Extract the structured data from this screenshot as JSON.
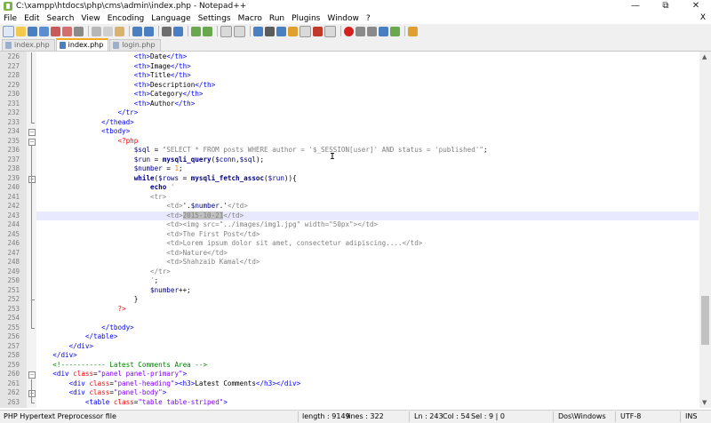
{
  "window": {
    "title": "C:\\xampp\\htdocs\\php\\cms\\admin\\index.php - Notepad++",
    "minimize": "—",
    "maximize": "⧉",
    "close": "✕"
  },
  "menu": {
    "items": [
      "File",
      "Edit",
      "Search",
      "View",
      "Encoding",
      "Language",
      "Settings",
      "Macro",
      "Run",
      "Plugins",
      "Window",
      "?"
    ],
    "close_x": "X"
  },
  "tabs": [
    {
      "label": "index.php",
      "active": false
    },
    {
      "label": "index.php",
      "active": true
    },
    {
      "label": "login.php",
      "active": false
    }
  ],
  "editor": {
    "current_line": 243,
    "lines": [
      {
        "n": 226,
        "html": "                        <span class='c-tag'>&lt;th&gt;</span>Date<span class='c-tag'>&lt;/th&gt;</span>"
      },
      {
        "n": 227,
        "html": "                        <span class='c-tag'>&lt;th&gt;</span>Image<span class='c-tag'>&lt;/th&gt;</span>"
      },
      {
        "n": 228,
        "html": "                        <span class='c-tag'>&lt;th&gt;</span>Title<span class='c-tag'>&lt;/th&gt;</span>"
      },
      {
        "n": 229,
        "html": "                        <span class='c-tag'>&lt;th&gt;</span>Description<span class='c-tag'>&lt;/th&gt;</span>"
      },
      {
        "n": 230,
        "html": "                        <span class='c-tag'>&lt;th&gt;</span>Category<span class='c-tag'>&lt;/th&gt;</span>"
      },
      {
        "n": 231,
        "html": "                        <span class='c-tag'>&lt;th&gt;</span>Author<span class='c-tag'>&lt;/th&gt;</span>"
      },
      {
        "n": 232,
        "html": "                    <span class='c-tag'>&lt;/tr&gt;</span>"
      },
      {
        "n": 233,
        "html": "                <span class='c-tag'>&lt;/thead&gt;</span>"
      },
      {
        "n": 234,
        "html": "                <span class='c-tag'>&lt;tbody&gt;</span>"
      },
      {
        "n": 235,
        "html": "                    <span class='c-php'>&lt;?php</span>"
      },
      {
        "n": 236,
        "html": "                        <span class='c-var'>$sql</span> = <span class='c-html-in-str'>\"SELECT * FROM posts WHERE author = '$_SESSION[user]' AND status = 'published'\"</span>;"
      },
      {
        "n": 237,
        "html": "                        <span class='c-var'>$run</span> = <span class='c-kw'>mysqli_query</span>(<span class='c-var'>$conn</span>,<span class='c-var'>$sql</span>);"
      },
      {
        "n": 238,
        "html": "                        <span class='c-var'>$number</span> = <span class='c-num'>1</span>;"
      },
      {
        "n": 239,
        "html": "                        <span class='c-kw'>while</span>(<span class='c-var'>$rows</span> = <span class='c-kw'>mysqli_fetch_assoc</span>(<span class='c-var'>$run</span>)){"
      },
      {
        "n": 240,
        "html": "                            <span class='c-echo'>echo</span> <span class='c-html-in-str'>'</span>"
      },
      {
        "n": 241,
        "html": "                            <span class='c-html-in-str'>&lt;tr&gt;</span>"
      },
      {
        "n": 242,
        "html": "                                <span class='c-html-in-str'>&lt;td&gt;</span>'.<span class='c-var'>$number</span>.'<span class='c-html-in-str'>&lt;/td&gt;</span>"
      },
      {
        "n": 243,
        "html": "                                <span class='c-html-in-str'>&lt;td&gt;<span class='c-sel'>2015-10-21</span>&lt;/td&gt;</span>"
      },
      {
        "n": 244,
        "html": "                                <span class='c-html-in-str'>&lt;td&gt;&lt;img src=\"../images/img1.jpg\" width=\"50px\"&gt;&lt;/td&gt;</span>"
      },
      {
        "n": 245,
        "html": "                                <span class='c-html-in-str'>&lt;td&gt;The First Post&lt;/td&gt;</span>"
      },
      {
        "n": 246,
        "html": "                                <span class='c-html-in-str'>&lt;td&gt;Lorem ipsum dolor sit amet, consectetur adipiscing....&lt;/td&gt;</span>"
      },
      {
        "n": 247,
        "html": "                                <span class='c-html-in-str'>&lt;td&gt;Nature&lt;/td&gt;</span>"
      },
      {
        "n": 248,
        "html": "                                <span class='c-html-in-str'>&lt;td&gt;Shahzaib Kamal&lt;/td&gt;</span>"
      },
      {
        "n": 249,
        "html": "                            <span class='c-html-in-str'>&lt;/tr&gt;</span>"
      },
      {
        "n": 250,
        "html": "                            <span class='c-html-in-str'>'</span>;"
      },
      {
        "n": 251,
        "html": "                            <span class='c-var'>$number</span>++;"
      },
      {
        "n": 252,
        "html": "                        }"
      },
      {
        "n": 253,
        "html": "                    <span class='c-php'>?&gt;</span>"
      },
      {
        "n": 254,
        "html": ""
      },
      {
        "n": 255,
        "html": "                <span class='c-tag'>&lt;/tbody&gt;</span>"
      },
      {
        "n": 256,
        "html": "            <span class='c-tag'>&lt;/table&gt;</span>"
      },
      {
        "n": 257,
        "html": "        <span class='c-tag'>&lt;/div&gt;</span>"
      },
      {
        "n": 258,
        "html": "    <span class='c-tag'>&lt;/div&gt;</span>"
      },
      {
        "n": 259,
        "html": "    <span class='c-cmt'>&lt;!----------- Latest Comments Area --&gt;</span>"
      },
      {
        "n": 260,
        "html": "    <span class='c-tag'>&lt;div</span> <span class='c-attr'>class</span>=<span class='c-str'>\"panel panel-primary\"</span><span class='c-tag'>&gt;</span>"
      },
      {
        "n": 261,
        "html": "        <span class='c-tag'>&lt;div</span> <span class='c-attr'>class</span>=<span class='c-str'>\"panel-heading\"</span><span class='c-tag'>&gt;&lt;h3&gt;</span>Latest Comments<span class='c-tag'>&lt;/h3&gt;&lt;/div&gt;</span>"
      },
      {
        "n": 262,
        "html": "        <span class='c-tag'>&lt;div</span> <span class='c-attr'>class</span>=<span class='c-str'>\"panel-body\"</span><span class='c-tag'>&gt;</span>"
      },
      {
        "n": 263,
        "html": "            <span class='c-tag'>&lt;table</span> <span class='c-attr'>class</span>=<span class='c-str'>\"table table-striped\"</span><span class='c-tag'>&gt;</span>"
      }
    ]
  },
  "status": {
    "filetype": "PHP Hypertext Preprocessor file",
    "length": "length : 9149",
    "lines": "lines : 322",
    "ln": "Ln : 243",
    "col": "Col : 54",
    "sel": "Sel : 9 | 0",
    "eol": "Dos\\Windows",
    "encoding": "UTF-8",
    "mode": "INS"
  }
}
